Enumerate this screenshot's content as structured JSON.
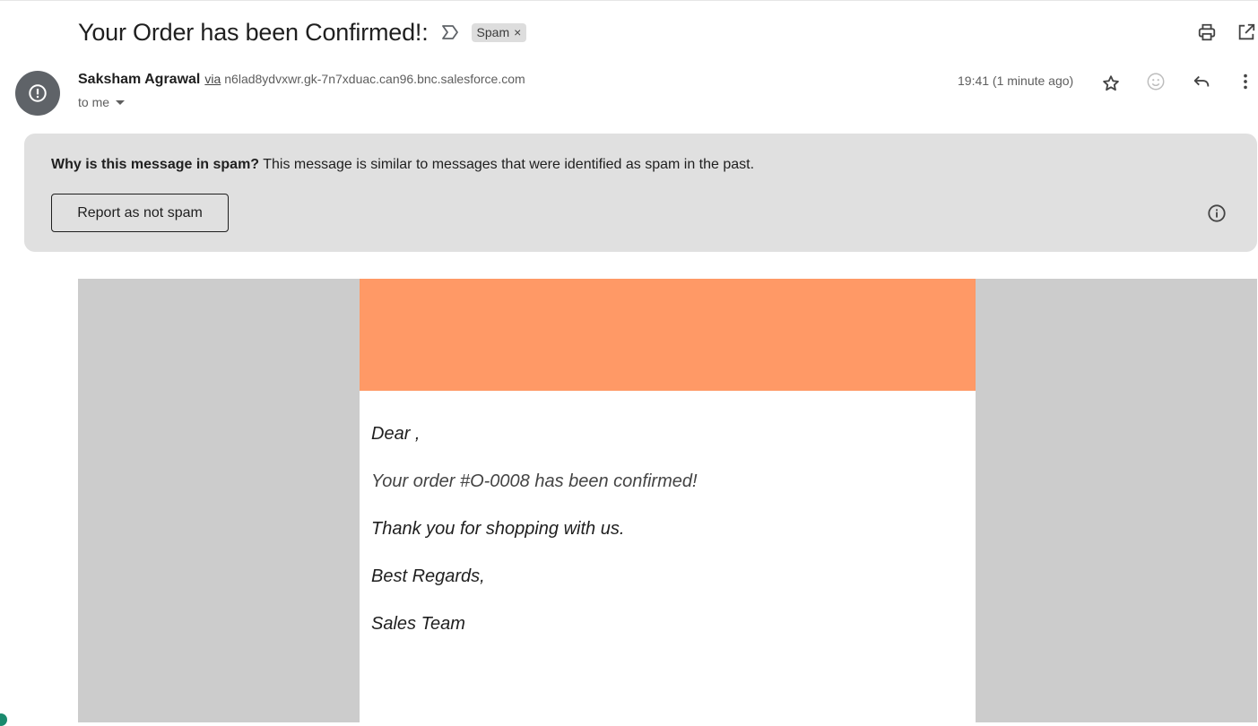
{
  "subject": "Your Order has been Confirmed!:",
  "label_chip": {
    "text": "Spam",
    "remove": "×"
  },
  "sender": {
    "name": "Saksham Agrawal",
    "via_label": "via",
    "via_domain": "n6lad8ydvxwr.gk-7n7xduac.can96.bnc.salesforce.com",
    "to": "to me",
    "timestamp": "19:41 (1 minute ago)"
  },
  "spam_banner": {
    "question": "Why is this message in spam?",
    "explanation": " This message is similar to messages that were identified as spam in the past.",
    "button": "Report as not spam"
  },
  "email_body": {
    "header_color": "#ff9966",
    "lines": [
      "Dear ,",
      "Your order #O-0008 has been confirmed!",
      "Thank you for shopping with us.",
      "Best Regards,",
      "Sales Team"
    ]
  },
  "icons": {
    "important": "important-marker-icon",
    "print": "print-icon",
    "open_new_window": "open-in-new-window-icon",
    "star": "star-icon",
    "emoji": "emoji-reaction-icon",
    "reply": "reply-icon",
    "more": "more-vert-icon",
    "info": "info-icon",
    "avatar": "spam-warning-icon"
  }
}
